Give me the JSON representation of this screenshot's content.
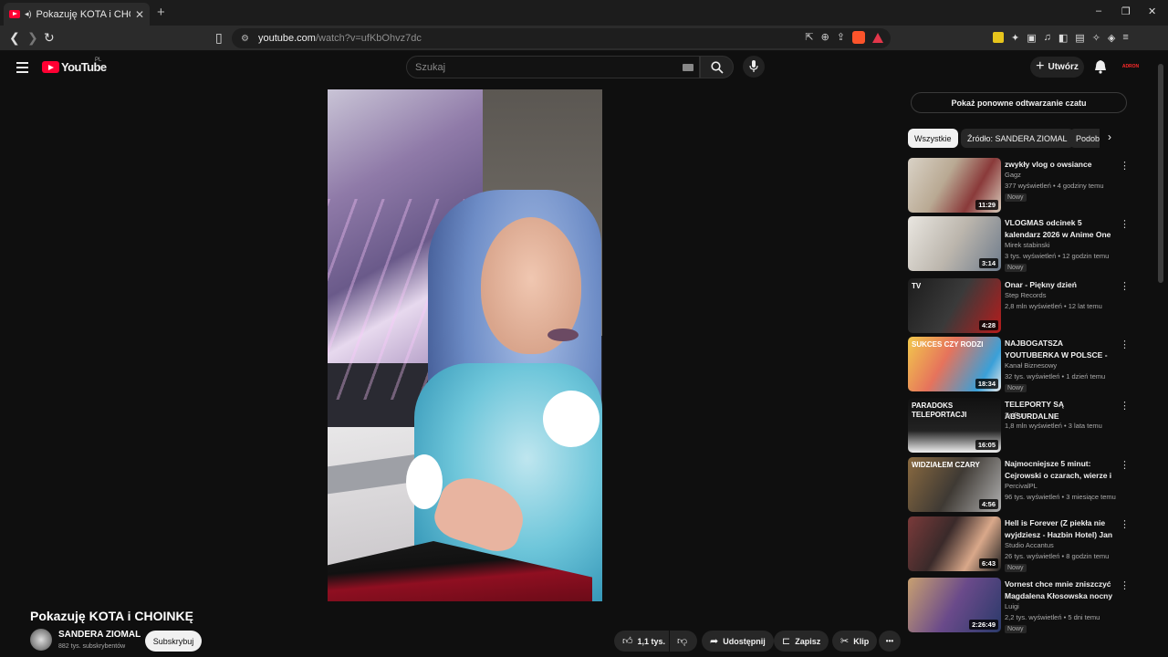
{
  "browser": {
    "tab_title": "Pokazuję KOTA i CHOINKĘ - YouTube",
    "new_tab": "+",
    "window_controls": [
      "–",
      "❐",
      "✕"
    ],
    "url_host": "youtube.com",
    "url_path": "/watch?v=ufKbOhvz7dc"
  },
  "header": {
    "logo_text": "YouTube",
    "country_code": "PL",
    "search_placeholder": "Szukaj",
    "create_label": "Utwórz",
    "account_label": "ADRON"
  },
  "video": {
    "title": "Pokazuję KOTA i CHOINKĘ",
    "channel": "SANDERA ZIOMAL",
    "subscribers": "882 tys. subskrybentów",
    "subscribe_label": "Subskrybuj",
    "likes": "1,1 tys.",
    "share_label": "Udostępnij",
    "save_label": "Zapisz",
    "clip_label": "Klip",
    "more_label": "•••"
  },
  "sidebar": {
    "chat_replay": "Pokaż ponowne odtwarzanie czatu",
    "chips": [
      "Wszystkie",
      "Źródło: SANDERA ZIOMAL",
      "Podobne"
    ],
    "recommendations": [
      {
        "title": "zwykły vlog o owsiance",
        "channel": "Gagz",
        "meta": "377 wyświetleń • 4 godziny temu",
        "badge": "Nowy",
        "duration": "11:29"
      },
      {
        "title": "VLOGMAS odcinek 5 kalendarz 2026 w Anime One Piece ...",
        "channel": "Mirek stabinski",
        "meta": "3 tys. wyświetleń • 12 godzin temu",
        "badge": "Nowy",
        "duration": "3:14"
      },
      {
        "title": "Onar - Piękny dzień",
        "channel": "Step Records",
        "meta": "2,8 mln wyświetleń • 12 lat temu",
        "badge": "",
        "duration": "4:28"
      },
      {
        "title": "NAJBOGATSZA YOUTUBERKA W POLSCE - JAK POWSTAŁA ...",
        "channel": "Kanał Biznesowy",
        "meta": "32 tys. wyświetleń • 1 dzień temu",
        "badge": "Nowy",
        "duration": "18:34"
      },
      {
        "title": "TELEPORTY SĄ ABSURDALNE",
        "channel": "SciFun",
        "meta": "1,8 mln wyświetleń • 3 lata temu",
        "badge": "",
        "duration": "16:05"
      },
      {
        "title": "Najmocniejsze 5 minut: Cejrowski o czarach, wierze i ...",
        "channel": "PercivalPL",
        "meta": "96 tys. wyświetleń • 3 miesiące temu",
        "badge": "",
        "duration": "4:56"
      },
      {
        "title": "Hell is Forever (Z piekła nie wyjdziesz - Hazbin Hotel) Jan ...",
        "channel": "Studio Accantus",
        "meta": "26 tys. wyświetleń • 8 godzin temu",
        "badge": "Nowy",
        "duration": "6:43"
      },
      {
        "title": "Vornest chce mnie zniszczyć Magdalena Kłosowska nocny ...",
        "channel": "Luigi",
        "meta": "2,2 tys. wyświetleń • 5 dni temu",
        "badge": "Nowy",
        "duration": "2:26:49"
      }
    ],
    "thumb_text": [
      "",
      "",
      "TV",
      "SUKCES CZY RODZI",
      "PARADOKS TELEPORTACJI",
      "WIDZIAŁEM CZARY",
      "",
      ""
    ]
  },
  "colors": {
    "background": "#0f0f0f",
    "brand_red": "#ff0033",
    "chip_active": "#f1f1f1"
  }
}
